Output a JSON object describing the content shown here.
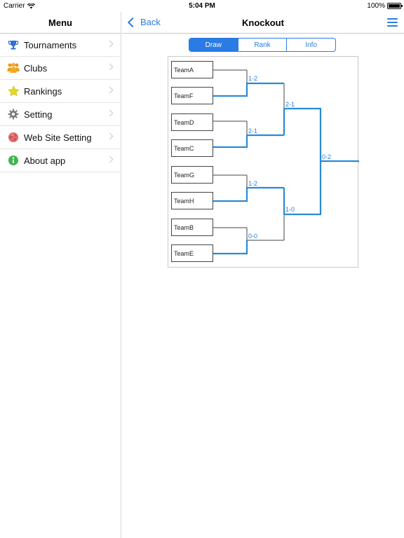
{
  "status_bar": {
    "carrier": "Carrier",
    "time": "5:04 PM",
    "battery": "100%"
  },
  "sidebar": {
    "title": "Menu",
    "items": [
      {
        "label": "Tournaments",
        "icon": "trophy-icon"
      },
      {
        "label": "Clubs",
        "icon": "people-icon"
      },
      {
        "label": "Rankings",
        "icon": "star-icon"
      },
      {
        "label": "Setting",
        "icon": "gear-icon"
      },
      {
        "label": "Web Site Setting",
        "icon": "globe-icon"
      },
      {
        "label": "About app",
        "icon": "info-icon"
      }
    ]
  },
  "header": {
    "back_label": "Back",
    "title": "Knockout"
  },
  "tabs": [
    {
      "label": "Draw",
      "active": true
    },
    {
      "label": "Rank",
      "active": false
    },
    {
      "label": "Info",
      "active": false
    }
  ],
  "bracket": {
    "teams": [
      "TeamA",
      "TeamF",
      "TeamD",
      "TeamC",
      "TeamG",
      "TeamH",
      "TeamB",
      "TeamE"
    ],
    "round1_scores": [
      "1-2",
      "2-1",
      "1-2",
      "0-0"
    ],
    "semifinal_scores": [
      "2-1",
      "1-0"
    ],
    "final_score": "0-2"
  },
  "colors": {
    "accent": "#2a7be4",
    "line": "#2a8ad4"
  }
}
